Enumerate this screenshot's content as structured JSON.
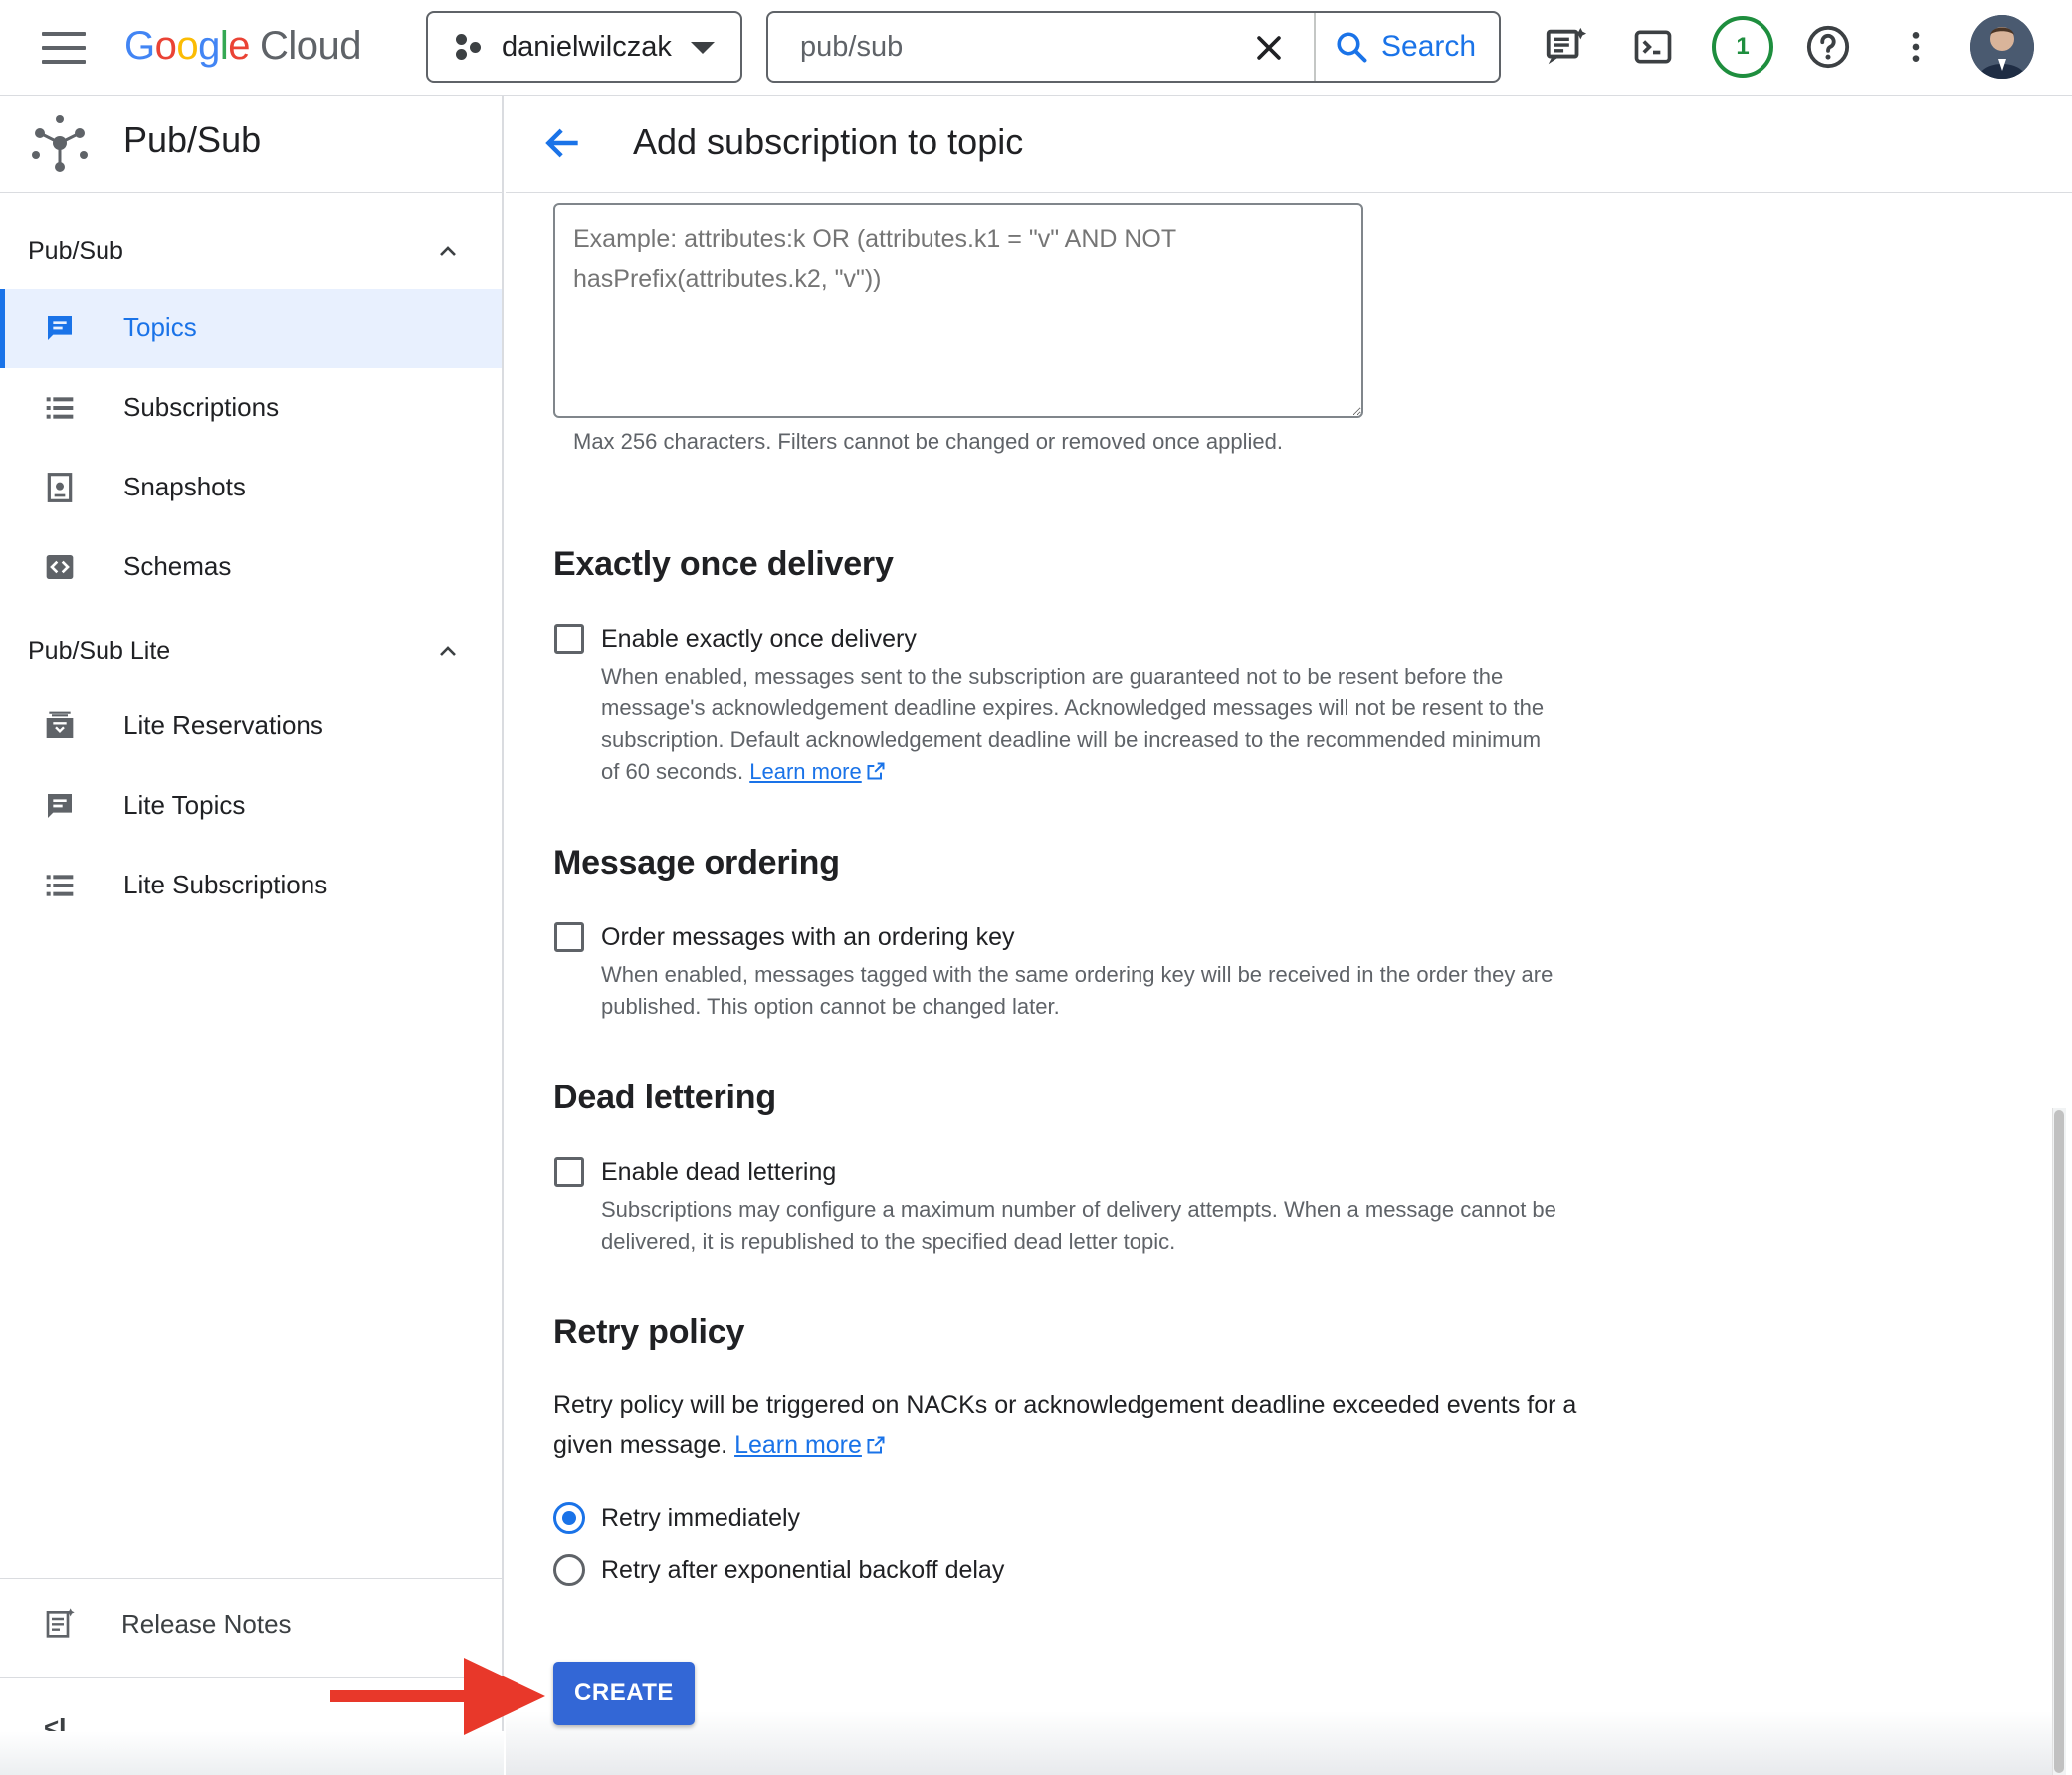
{
  "topbar": {
    "logo_parts": [
      "G",
      "o",
      "o",
      "g",
      "l",
      "e"
    ],
    "logo_cloud": "Cloud",
    "project": "danielwilczak",
    "search_value": "pub/sub",
    "search_button": "Search",
    "notification_count": "1",
    "icons": [
      "menu-icon",
      "gemini-chat-icon",
      "cloud-shell-icon",
      "help-icon",
      "more-vert-icon"
    ]
  },
  "sidenav": {
    "product": "Pub/Sub",
    "sections": [
      {
        "title": "Pub/Sub",
        "items": [
          {
            "label": "Topics",
            "icon": "topic-icon",
            "active": true
          },
          {
            "label": "Subscriptions",
            "icon": "list-icon"
          },
          {
            "label": "Snapshots",
            "icon": "snapshot-icon"
          },
          {
            "label": "Schemas",
            "icon": "schema-icon"
          }
        ]
      },
      {
        "title": "Pub/Sub Lite",
        "items": [
          {
            "label": "Lite Reservations",
            "icon": "reservation-icon"
          },
          {
            "label": "Lite Topics",
            "icon": "topic-icon"
          },
          {
            "label": "Lite Subscriptions",
            "icon": "list-icon"
          }
        ]
      }
    ],
    "release_notes": "Release Notes",
    "collapse": "<I"
  },
  "main": {
    "title": "Add subscription to topic",
    "filter": {
      "placeholder": "Example: attributes:k OR (attributes.k1 = \"v\" AND NOT hasPrefix(attributes.k2, \"v\"))",
      "helper": "Max 256 characters. Filters cannot be changed or removed once applied."
    },
    "exactly_once": {
      "heading": "Exactly once delivery",
      "checkbox_label": "Enable exactly once delivery",
      "checked": false,
      "description": "When enabled, messages sent to the subscription are guaranteed not to be resent before the message's acknowledgement deadline expires. Acknowledged messages will not be resent to the subscription. Default acknowledgement deadline will be increased to the recommended minimum of 60 seconds.",
      "learn_more": "Learn more"
    },
    "ordering": {
      "heading": "Message ordering",
      "checkbox_label": "Order messages with an ordering key",
      "checked": false,
      "description": "When enabled, messages tagged with the same ordering key will be received in the order they are published. This option cannot be changed later."
    },
    "dead_letter": {
      "heading": "Dead lettering",
      "checkbox_label": "Enable dead lettering",
      "checked": false,
      "description": "Subscriptions may configure a maximum number of delivery attempts. When a message cannot be delivered, it is republished to the specified dead letter topic."
    },
    "retry": {
      "heading": "Retry policy",
      "description": "Retry policy will be triggered on NACKs or acknowledgement deadline exceeded events for a given message.",
      "learn_more": "Learn more",
      "options": [
        {
          "label": "Retry immediately",
          "selected": true
        },
        {
          "label": "Retry after exponential backoff delay",
          "selected": false
        }
      ]
    },
    "create_button": "CREATE"
  },
  "colors": {
    "accent": "#1a73e8",
    "create_button": "#3367d6",
    "annotation_arrow": "#e8382a",
    "notification_ring": "#1e8e3e"
  }
}
